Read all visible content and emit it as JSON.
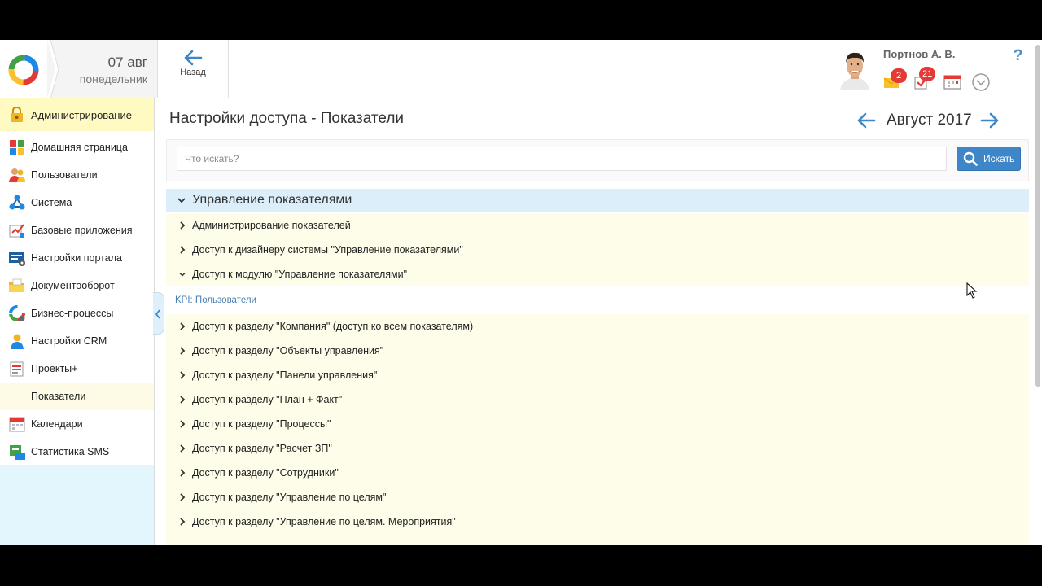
{
  "header": {
    "date_day": "07 авг",
    "date_weekday": "понедельник",
    "back_label": "Назад",
    "user_name": "Портнов А. В.",
    "messages_count": "2",
    "tasks_count": "21",
    "help": "?"
  },
  "sidebar": {
    "items": [
      {
        "label": "Администрирование",
        "icon": "key-lock-icon"
      },
      {
        "label": "Домашняя страница",
        "icon": "home-tiles-icon"
      },
      {
        "label": "Пользователи",
        "icon": "users-icon"
      },
      {
        "label": "Система",
        "icon": "system-nodes-icon"
      },
      {
        "label": "Базовые приложения",
        "icon": "base-apps-icon"
      },
      {
        "label": "Настройки портала",
        "icon": "portal-settings-icon"
      },
      {
        "label": "Документооборот",
        "icon": "folder-icon"
      },
      {
        "label": "Бизнес-процессы",
        "icon": "business-process-icon"
      },
      {
        "label": "Настройки CRM",
        "icon": "crm-icon"
      },
      {
        "label": "Проекты+",
        "icon": "projects-icon"
      },
      {
        "label": "Показатели",
        "icon": ""
      },
      {
        "label": "Календари",
        "icon": "calendar-icon"
      },
      {
        "label": "Статистика SMS",
        "icon": "sms-icon"
      }
    ]
  },
  "main": {
    "title": "Настройки доступа - Показатели",
    "month": "Август 2017",
    "search": {
      "placeholder": "Что искать?",
      "button": "Искать"
    },
    "group": "Управление показателями",
    "rows_top": [
      {
        "label": "Администрирование показателей",
        "expanded": false
      },
      {
        "label": "Доступ к дизайнеру системы \"Управление показателями\"",
        "expanded": false
      },
      {
        "label": "Доступ к модулю \"Управление показателями\"",
        "expanded": true
      }
    ],
    "subgroup": "KPI: Пользователи",
    "rows_bottom": [
      "Доступ к разделу \"Компания\" (доступ ко всем показателям)",
      "Доступ к разделу \"Объекты управления\"",
      "Доступ к разделу \"Панели управления\"",
      "Доступ к разделу \"План + Факт\"",
      "Доступ к разделу \"Процессы\"",
      "Доступ к разделу \"Расчет ЗП\"",
      "Доступ к разделу \"Сотрудники\"",
      "Доступ к разделу \"Управление по целям\"",
      "Доступ к разделу \"Управление по целям. Мероприятия\""
    ]
  },
  "colors": {
    "accent": "#3e86c8",
    "row_bg": "#fefde9",
    "group_bg": "#dbeef9",
    "sidebar_active": "#fffac2",
    "badge": "#e53935"
  }
}
